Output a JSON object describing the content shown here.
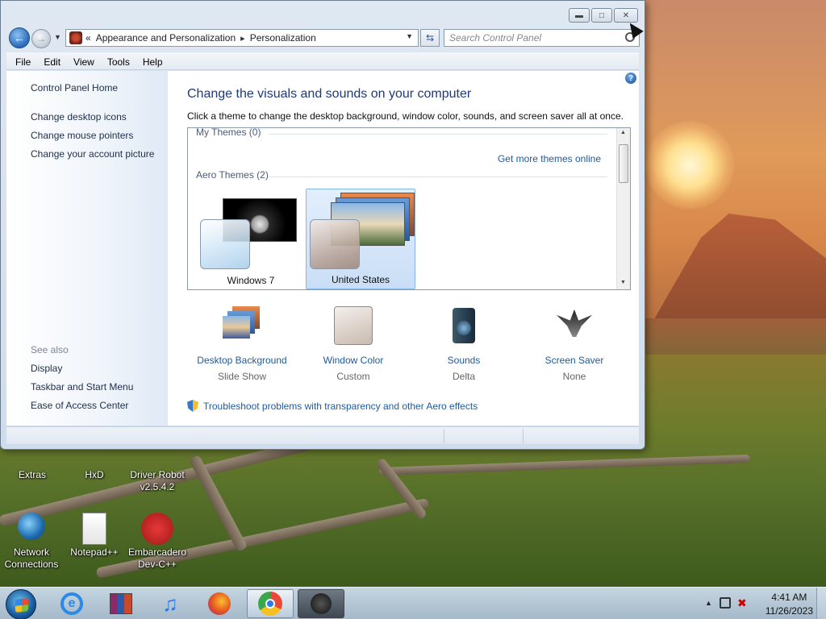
{
  "window": {
    "caption_buttons": [
      "minimize",
      "maximize",
      "close"
    ]
  },
  "navigation": {
    "breadcrumb_prefix": "«",
    "breadcrumb": [
      "Appearance and Personalization",
      "Personalization"
    ],
    "search_placeholder": "Search Control Panel"
  },
  "menubar": {
    "items": [
      "File",
      "Edit",
      "View",
      "Tools",
      "Help"
    ]
  },
  "sidebar": {
    "home": "Control Panel Home",
    "links": [
      "Change desktop icons",
      "Change mouse pointers",
      "Change your account picture"
    ],
    "see_also_heading": "See also",
    "see_also": [
      "Display",
      "Taskbar and Start Menu",
      "Ease of Access Center"
    ]
  },
  "main": {
    "title": "Change the visuals and sounds on your computer",
    "description": "Click a theme to change the desktop background, window color, sounds, and screen saver all at once.",
    "groups": {
      "my_themes": "My Themes (0)",
      "more_themes_link": "Get more themes online",
      "aero_themes": "Aero Themes (2)"
    },
    "themes": [
      {
        "name": "Windows 7",
        "selected": false
      },
      {
        "name": "United States",
        "selected": true
      }
    ],
    "tools": [
      {
        "label": "Desktop Background",
        "value": "Slide Show",
        "icon": "desktop-background-icon"
      },
      {
        "label": "Window Color",
        "value": "Custom",
        "icon": "window-color-icon"
      },
      {
        "label": "Sounds",
        "value": "Delta",
        "icon": "sounds-icon"
      },
      {
        "label": "Screen Saver",
        "value": "None",
        "icon": "screen-saver-icon"
      }
    ],
    "troubleshoot": "Troubleshoot problems with transparency and other Aero effects"
  },
  "desktop_icons": [
    {
      "label": "Extras"
    },
    {
      "label": "HxD"
    },
    {
      "label": "Driver Robot v2.5.4.2"
    },
    {
      "label": "Network Connections"
    },
    {
      "label": "Notepad++"
    },
    {
      "label": "Embarcadero Dev-C++"
    }
  ],
  "taskbar": {
    "pinned": [
      "internet-explorer-icon",
      "winrar-icon",
      "itunes-icon",
      "firefox-icon",
      "chrome-icon",
      "paint-app-icon"
    ],
    "clock_time": "4:41 AM",
    "clock_date": "11/26/2023"
  }
}
